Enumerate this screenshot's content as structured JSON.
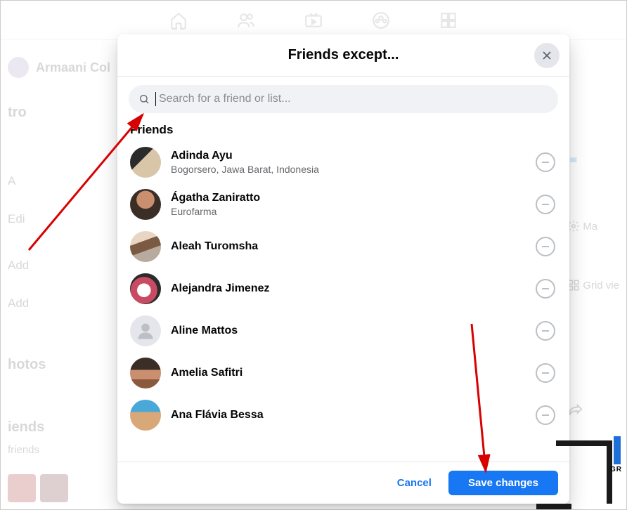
{
  "bg": {
    "profile_name": "Armaani Col",
    "side": [
      "tro",
      "A",
      "Edi",
      "Add",
      "Add",
      "hotos",
      "iends",
      " friends"
    ],
    "right": [
      {
        "icon": "flag",
        "text": ""
      },
      {
        "icon": "gear",
        "text": "Ma"
      },
      {
        "icon": "grid",
        "text": "Grid vie"
      }
    ]
  },
  "modal": {
    "title": "Friends except...",
    "search_placeholder": "Search for a friend or list...",
    "section_label": "Friends",
    "cancel_label": "Cancel",
    "save_label": "Save changes"
  },
  "friends": [
    {
      "name": "Adinda Ayu",
      "sub": "Bogorsero, Jawa Barat, Indonesia",
      "avatar_class": "av-1"
    },
    {
      "name": "Ágatha Zaniratto",
      "sub": "Eurofarma",
      "avatar_class": "av-2"
    },
    {
      "name": "Aleah Turomsha",
      "sub": "",
      "avatar_class": "av-3"
    },
    {
      "name": "Alejandra Jimenez",
      "sub": "",
      "avatar_class": "av-4"
    },
    {
      "name": "Aline Mattos",
      "sub": "",
      "avatar_class": "av-5"
    },
    {
      "name": "Amelia Safitri",
      "sub": "",
      "avatar_class": "av-6"
    },
    {
      "name": "Ana Flávia Bessa",
      "sub": "",
      "avatar_class": "av-7"
    }
  ]
}
